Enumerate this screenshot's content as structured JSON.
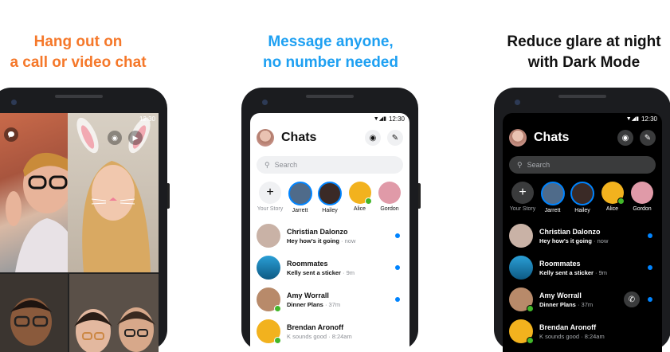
{
  "colors": {
    "orange": "#f5782a",
    "blue": "#1ea0f2",
    "black": "#111111",
    "messenger_blue": "#0084ff"
  },
  "captions": [
    {
      "line1": "Hang out on",
      "line2": "a call or video chat"
    },
    {
      "line1": "Message anyone,",
      "line2": "no number needed"
    },
    {
      "line1": "Reduce glare at night",
      "line2": "with Dark Mode"
    }
  ],
  "status_time": "12:30",
  "chats": {
    "title": "Chats",
    "search_placeholder": "Search",
    "camera_icon": "camera-icon",
    "compose_icon": "pencil-icon",
    "stories": [
      {
        "name": "Your Story"
      },
      {
        "name": "Jarrett"
      },
      {
        "name": "Hailey"
      },
      {
        "name": "Alice"
      },
      {
        "name": "Gordon"
      }
    ],
    "rows": [
      {
        "name": "Christian Dalonzo",
        "message": "Hey how's it going",
        "time": " · now"
      },
      {
        "name": "Roommates",
        "message": "Kelly sent a sticker",
        "time": " · 9m"
      },
      {
        "name": "Amy Worrall",
        "message": "Dinner Plans",
        "time": " · 37m"
      },
      {
        "name": "Brendan Aronoff",
        "message": "K sounds good",
        "time": " · 8:24am"
      }
    ]
  }
}
